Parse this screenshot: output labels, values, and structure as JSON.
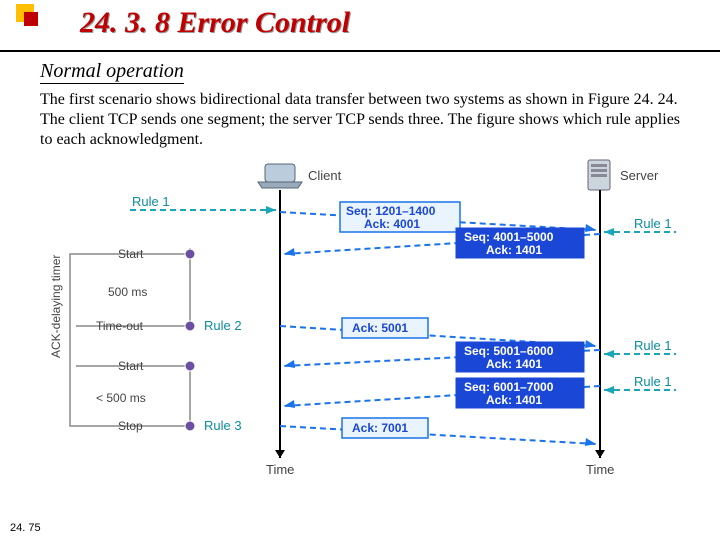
{
  "header": {
    "title": "24. 3. 8  Error Control"
  },
  "subhead": "Normal operation",
  "paragraph": "The first scenario shows bidirectional data transfer between two systems as shown in Figure 24. 24. The client TCP sends one segment; the server TCP sends three. The figure shows which rule applies to each acknowledgment.",
  "page_number": "24. 75",
  "figure": {
    "client_label": "Client",
    "server_label": "Server",
    "time_label_left": "Time",
    "time_label_right": "Time",
    "timer_label": "ACK-delaying\ntimer",
    "events": [
      {
        "label": "Start"
      },
      {
        "label": "500 ms"
      },
      {
        "label": "Time-out"
      },
      {
        "label": "Start"
      },
      {
        "label": "< 500 ms"
      },
      {
        "label": "Stop"
      }
    ],
    "left_rule": "Rule 1",
    "left_rules": [
      "Rule 2",
      "Rule 3"
    ],
    "right_rules": [
      "Rule 1",
      "Rule 1",
      "Rule 1"
    ],
    "client_segment": {
      "seq": "Seq: 1201–1400",
      "ack": "Ack: 4001"
    },
    "server_segments": [
      {
        "seq": "Seq: 4001–5000",
        "ack": "Ack: 1401"
      },
      {
        "seq": "Seq: 5001–6000",
        "ack": "Ack: 1401"
      },
      {
        "seq": "Seq: 6001–7000",
        "ack": "Ack: 1401"
      }
    ],
    "client_acks": [
      "Ack: 5001",
      "Ack: 7001"
    ],
    "colors": {
      "teal": "#1aa5b8",
      "blue": "#1a73e8",
      "navy": "#1a47d6"
    }
  }
}
